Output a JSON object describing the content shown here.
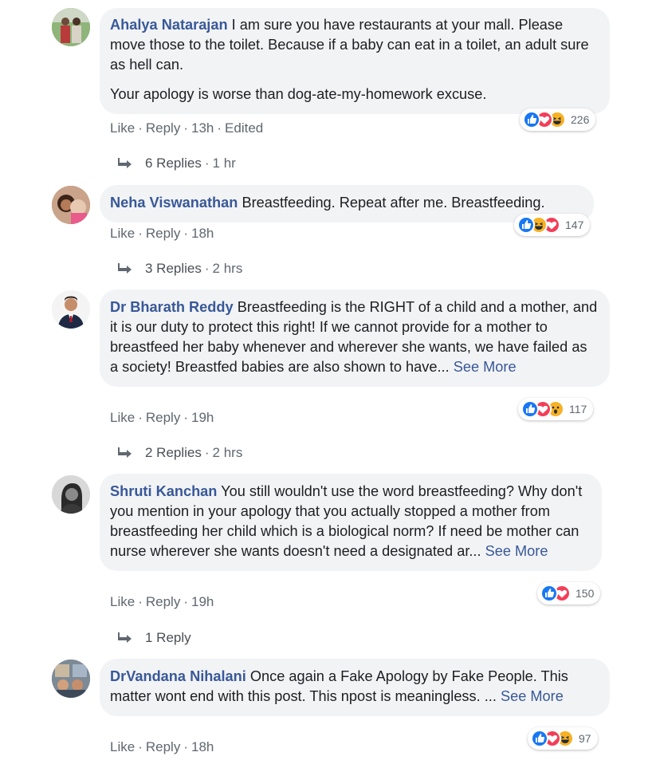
{
  "comments": [
    {
      "author": "Ahalya Natarajan",
      "text": "I am sure you have restaurants at your mall. Please move those to the toilet. Because if a baby can eat in a toilet, an adult sure as hell can.",
      "text2": "Your apology is worse than dog-ate-my-homework excuse.",
      "like": "Like",
      "reply": "Reply",
      "time": "13h",
      "edited": "Edited",
      "reaction_count": "226",
      "reactions": [
        "like",
        "love",
        "haha"
      ],
      "replies": "6 Replies",
      "replies_time": "1 hr"
    },
    {
      "author": "Neha Viswanathan",
      "text": "Breastfeeding. Repeat after me. Breastfeeding.",
      "like": "Like",
      "reply": "Reply",
      "time": "18h",
      "reaction_count": "147",
      "reactions": [
        "like",
        "haha",
        "love"
      ],
      "replies": "3 Replies",
      "replies_time": "2 hrs"
    },
    {
      "author": "Dr Bharath Reddy",
      "text": "Breastfeeding is the RIGHT of a child and a mother, and it is our duty to protect this right! If we cannot provide for a mother to breastfeed her baby whenever and wherever she wants, we have failed as a society! Breastfed babies are also shown to have...",
      "see_more": "See More",
      "like": "Like",
      "reply": "Reply",
      "time": "19h",
      "reaction_count": "117",
      "reactions": [
        "like",
        "love",
        "wow"
      ],
      "replies": "2 Replies",
      "replies_time": "2 hrs"
    },
    {
      "author": "Shruti Kanchan",
      "text": "You still wouldn't use the word breastfeeding? Why don't you mention in your apology that you actually stopped a mother from breastfeeding her child which is a biological norm? If need be mother can nurse wherever she wants doesn't need a designated ar...",
      "see_more": "See More",
      "like": "Like",
      "reply": "Reply",
      "time": "19h",
      "reaction_count": "150",
      "reactions": [
        "like",
        "love"
      ],
      "replies": "1 Reply"
    },
    {
      "author": "DrVandana Nihalani",
      "text": "Once again a Fake Apology by Fake People. This matter wont end with this post. This npost is meaningless. ...",
      "see_more": "See More",
      "like": "Like",
      "reply": "Reply",
      "time": "18h",
      "reaction_count": "97",
      "reactions": [
        "like",
        "love",
        "haha"
      ]
    }
  ],
  "colors": {
    "link": "#385898",
    "bubble": "#f2f3f5",
    "meta": "#606770",
    "like": "#1877f2",
    "love": "#f33e58",
    "haha": "#f7b125"
  }
}
